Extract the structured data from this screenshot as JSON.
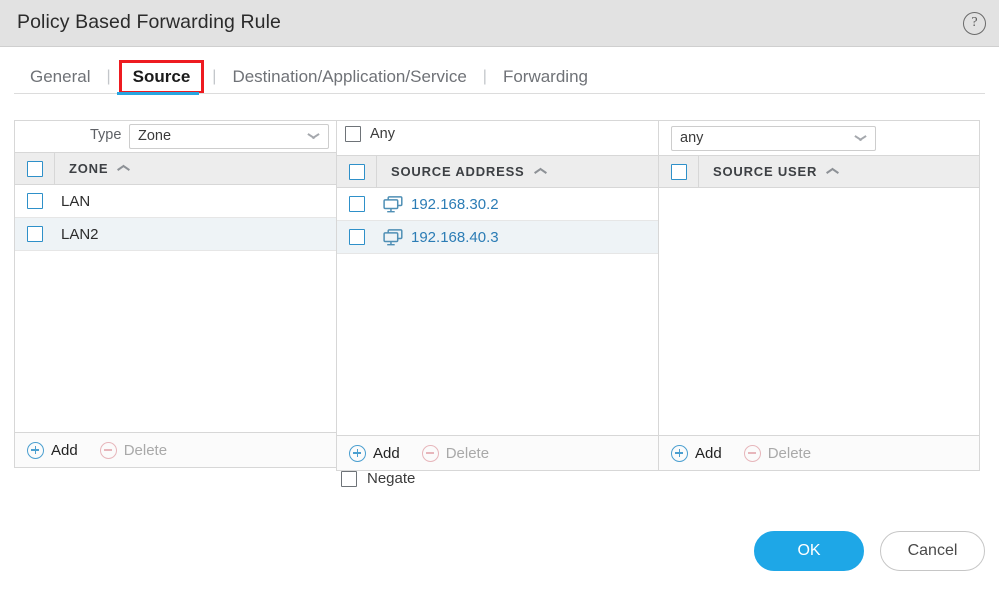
{
  "window": {
    "title": "Policy Based Forwarding Rule",
    "help_icon": "help-circle-icon",
    "help_glyph": "?"
  },
  "tabs": {
    "separator": "|",
    "items": [
      {
        "label": "General",
        "active": false,
        "highlighted": false
      },
      {
        "label": "Source",
        "active": true,
        "highlighted": true
      },
      {
        "label": "Destination/Application/Service",
        "active": false,
        "highlighted": false
      },
      {
        "label": "Forwarding",
        "active": false,
        "highlighted": false
      }
    ]
  },
  "source": {
    "zone_panel": {
      "type_label": "Type",
      "type_value": "Zone",
      "column_header": "ZONE",
      "sort_icon": "caret-up-icon",
      "rows": [
        {
          "label": "LAN",
          "checked": false
        },
        {
          "label": "LAN2",
          "checked": false
        }
      ],
      "add_label": "Add",
      "delete_label": "Delete"
    },
    "address_panel": {
      "any_label": "Any",
      "any_checked": false,
      "column_header": "SOURCE ADDRESS",
      "sort_icon": "caret-up-icon",
      "rows": [
        {
          "label": "192.168.30.2",
          "icon": "device-address-icon",
          "checked": false
        },
        {
          "label": "192.168.40.3",
          "icon": "device-address-icon",
          "checked": false
        }
      ],
      "add_label": "Add",
      "delete_label": "Delete"
    },
    "user_panel": {
      "select_value": "any",
      "column_header": "SOURCE USER",
      "sort_icon": "caret-up-icon",
      "rows": [],
      "add_label": "Add",
      "delete_label": "Delete"
    },
    "negate": {
      "label": "Negate",
      "checked": false
    }
  },
  "footer": {
    "ok_label": "OK",
    "cancel_label": "Cancel"
  },
  "colors": {
    "accent_blue": "#1ea7e7",
    "tab_underline": "#28a5e0",
    "highlight_red": "#ee1b20",
    "link_blue": "#2b7cb5",
    "titlebar_gray": "#e2e2e2",
    "header_gray": "#ededed",
    "alt_row": "#eef3f6"
  }
}
